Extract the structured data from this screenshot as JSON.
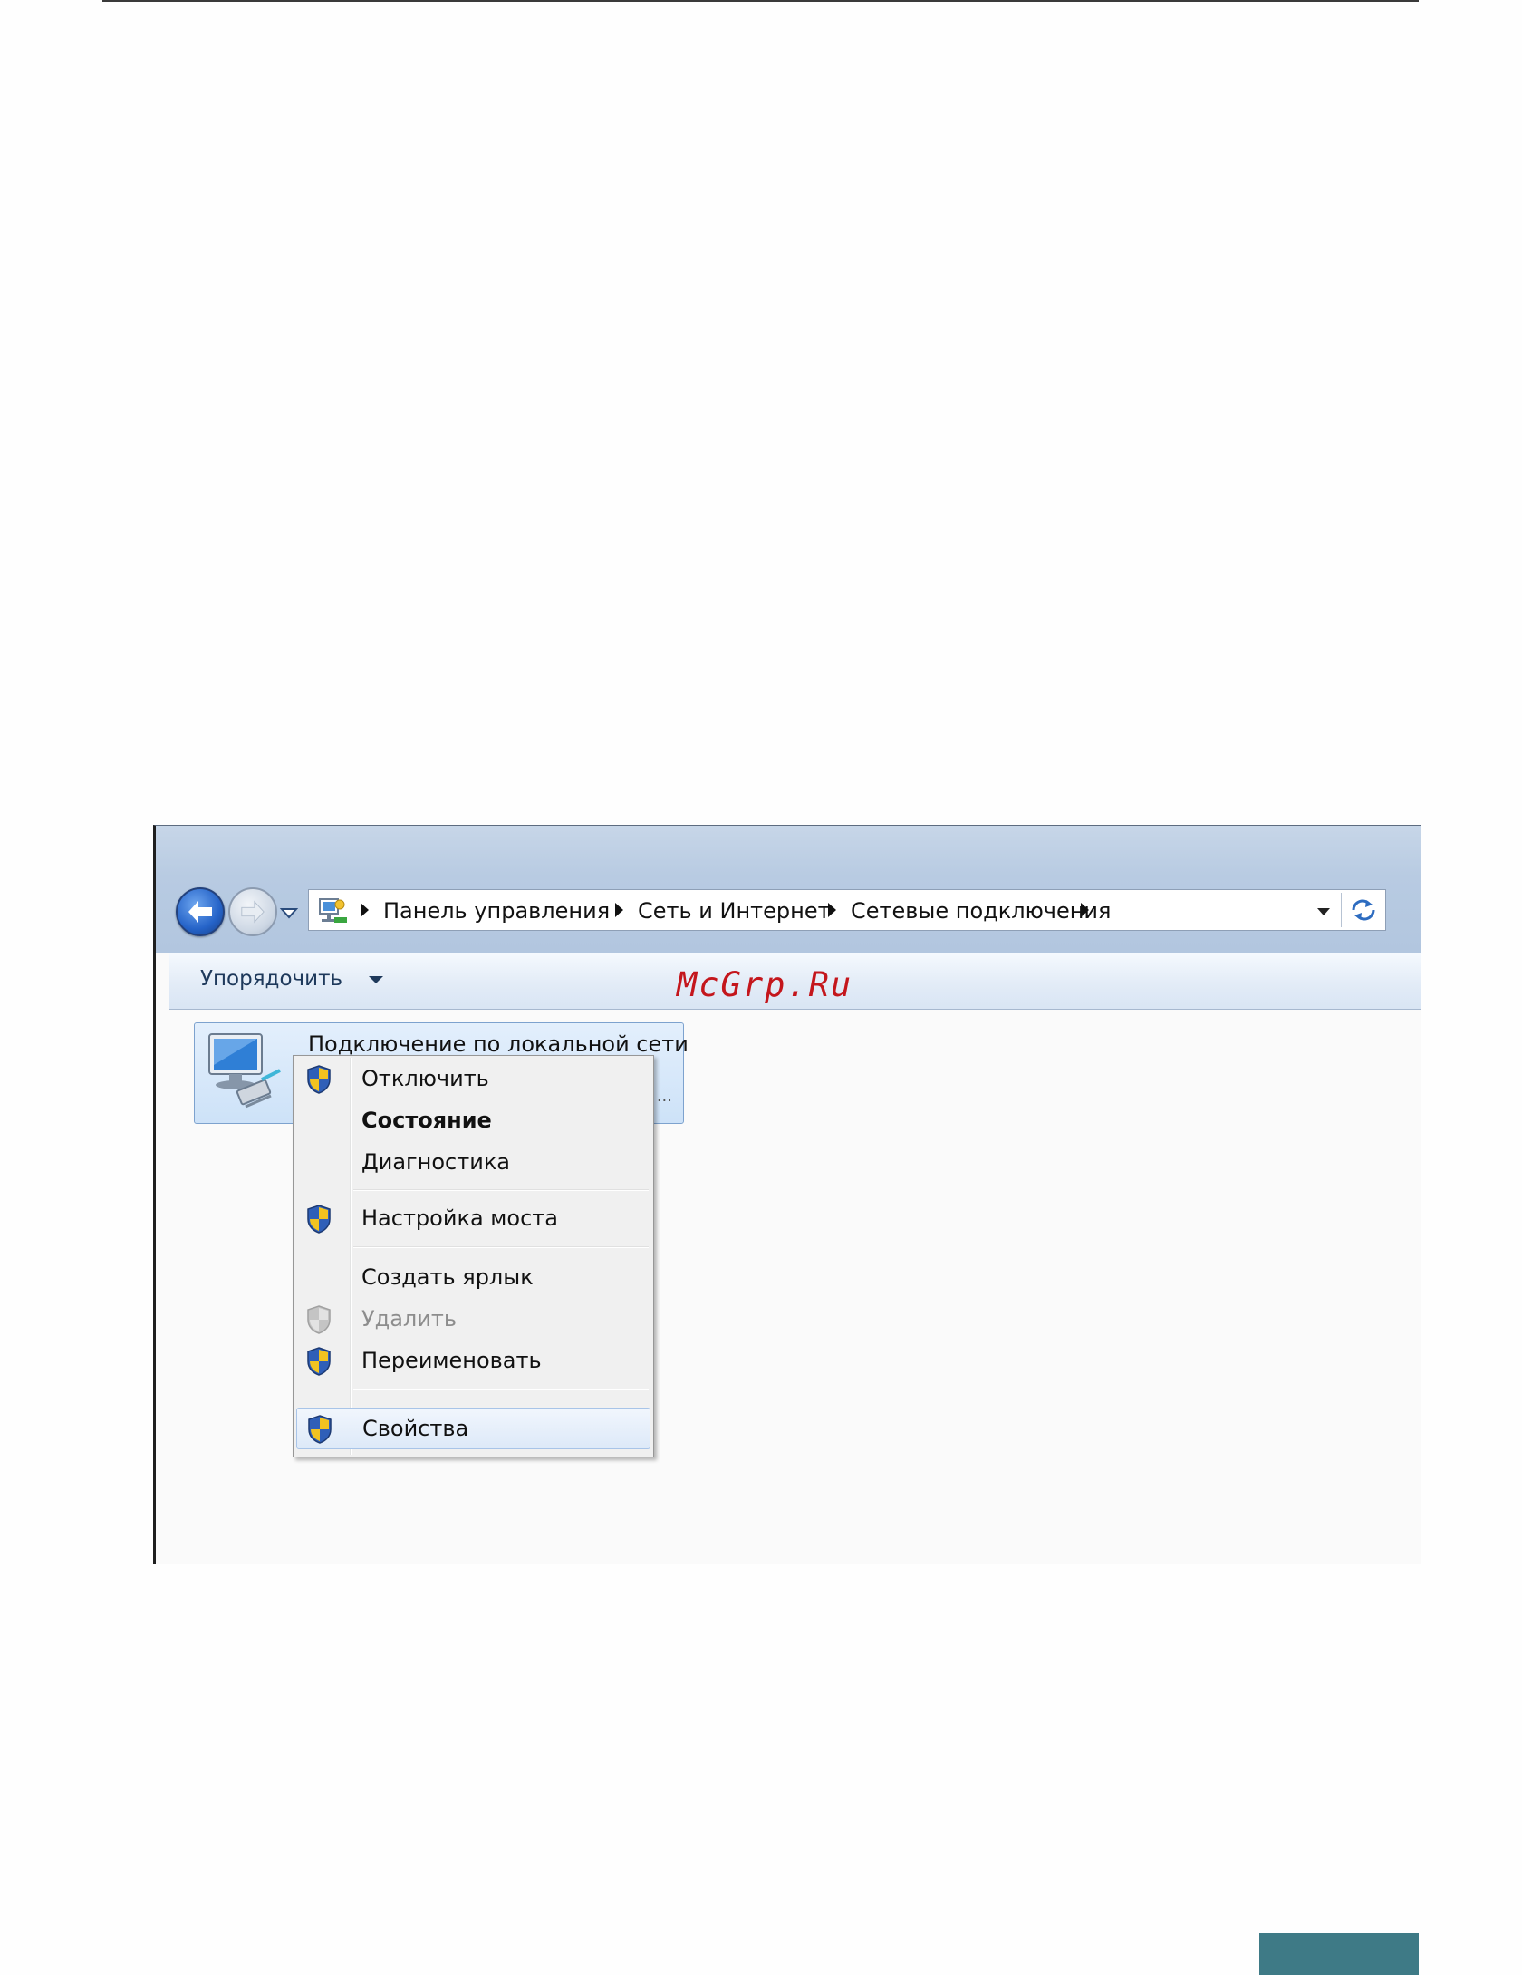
{
  "breadcrumb": {
    "items": [
      "Панель управления",
      "Сеть и Интернет",
      "Сетевые подключения"
    ]
  },
  "toolbar": {
    "organize_label": "Упорядочить"
  },
  "watermark": {
    "text": "McGrp.Ru"
  },
  "connection": {
    "title": "Подключение по локальной сети",
    "ellipsis": "..."
  },
  "context_menu": {
    "items": [
      {
        "label": "Отключить",
        "icon": "shield-icon",
        "style": "normal"
      },
      {
        "label": "Состояние",
        "icon": "",
        "style": "bold"
      },
      {
        "label": "Диагностика",
        "icon": "",
        "style": "normal"
      },
      {
        "label": "Настройка моста",
        "icon": "shield-icon",
        "style": "normal"
      },
      {
        "label": "Создать ярлык",
        "icon": "",
        "style": "normal"
      },
      {
        "label": "Удалить",
        "icon": "shield-icon",
        "style": "disabled"
      },
      {
        "label": "Переименовать",
        "icon": "shield-icon",
        "style": "normal"
      },
      {
        "label": "Свойства",
        "icon": "shield-icon",
        "style": "highlighted"
      }
    ]
  },
  "colors": {
    "accent_block": "#3e7a86",
    "watermark": "#c4161c",
    "menu_highlight": "#dde9f8"
  }
}
